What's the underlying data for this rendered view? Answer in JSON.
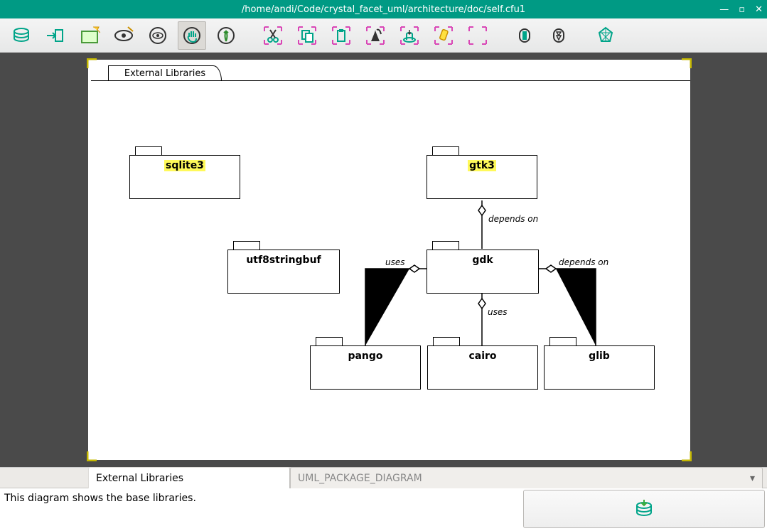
{
  "window": {
    "title": "/home/andi/Code/crystal_facet_uml/architecture/doc/self.cfu1"
  },
  "toolbar": {
    "icons": [
      {
        "name": "database-icon"
      },
      {
        "name": "export-icon"
      },
      {
        "name": "new-window-icon"
      },
      {
        "name": "new-view-icon"
      },
      {
        "name": "eye-icon"
      },
      {
        "name": "hand-icon"
      },
      {
        "name": "create-icon"
      },
      {
        "name": "cut-icon"
      },
      {
        "name": "copy-icon"
      },
      {
        "name": "paste-icon"
      },
      {
        "name": "delete-icon"
      },
      {
        "name": "instantiate-icon"
      },
      {
        "name": "highlight-icon"
      },
      {
        "name": "reset-icon"
      },
      {
        "name": "undo-icon"
      },
      {
        "name": "redo-icon"
      },
      {
        "name": "about-icon"
      }
    ]
  },
  "diagram": {
    "frame_title": "External Libraries",
    "packages": {
      "sqlite3": "sqlite3",
      "gtk3": "gtk3",
      "utf8stringbuf": "utf8stringbuf",
      "gdk": "gdk",
      "pango": "pango",
      "cairo": "cairo",
      "glib": "glib"
    },
    "relations": {
      "depends_on_1": "depends on",
      "uses_1": "uses",
      "depends_on_2": "depends on",
      "uses_2": "uses"
    }
  },
  "footer": {
    "tab_name": "External Libraries",
    "tab_type": "UML_PACKAGE_DIAGRAM",
    "description": "This diagram shows the base libraries."
  }
}
